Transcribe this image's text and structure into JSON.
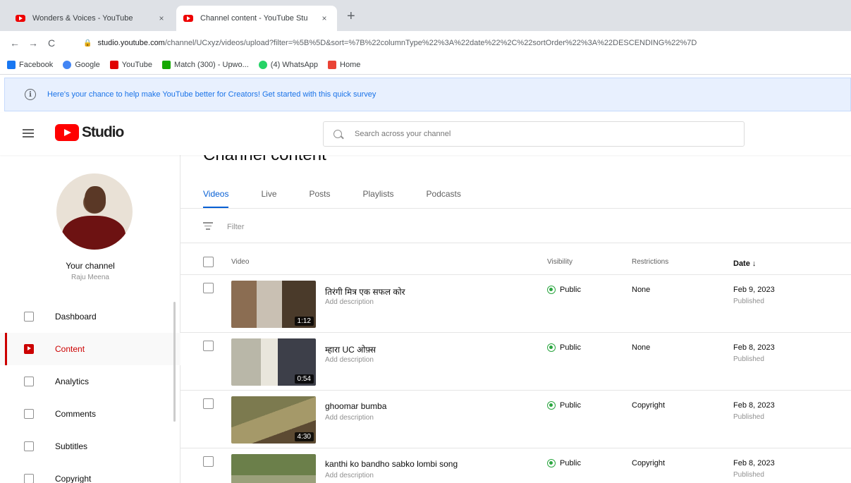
{
  "browser": {
    "tabs": [
      {
        "title": "Wonders & Voices - YouTube",
        "close": "×"
      },
      {
        "title": "Channel content - YouTube Stu",
        "close": "×"
      }
    ],
    "new_tab": "+",
    "nav": {
      "back": "←",
      "forward": "→",
      "reload": "C"
    },
    "url_host": "studio.youtube.com",
    "url_path": "/channel/UCxyz/videos/upload?filter=%5B%5D&sort=%7B%22columnType%22%3A%22date%22%2C%22sortOrder%22%3A%22DESCENDING%22%7D",
    "lock": "🔒",
    "bookmarks": [
      {
        "label": "Facebook",
        "color": "#1877f2"
      },
      {
        "label": "Google",
        "color": "#4285f4"
      },
      {
        "label": "YouTube",
        "color": "#e00000"
      },
      {
        "label": "Match (300) - Upwo...",
        "color": "#14a800"
      },
      {
        "label": "(4) WhatsApp",
        "color": "#25d366"
      },
      {
        "label": "Home",
        "color": "#ea4335"
      }
    ]
  },
  "survey": {
    "icon": "i",
    "text": "Here's your chance to help make YouTube better for Creators! Get started with this quick survey"
  },
  "studio": {
    "logo_text": "Studio",
    "search_placeholder": "Search across your channel"
  },
  "sidebar": {
    "channel_title": "Your channel",
    "channel_name": "Raju Meena",
    "items": [
      {
        "label": "Dashboard",
        "active": false
      },
      {
        "label": "Content",
        "active": true
      },
      {
        "label": "Analytics",
        "active": false
      },
      {
        "label": "Comments",
        "active": false
      },
      {
        "label": "Subtitles",
        "active": false
      },
      {
        "label": "Copyright",
        "active": false
      }
    ]
  },
  "main": {
    "title": "Channel content",
    "tabs": [
      "Videos",
      "Live",
      "Posts",
      "Playlists",
      "Podcasts"
    ],
    "filter": "Filter",
    "headers": {
      "video": "Video",
      "visibility": "Visibility",
      "restrictions": "Restrictions",
      "date": "Date ↓"
    },
    "rows": [
      {
        "title": "तिरंगी मित्र एक सफल कोर",
        "desc": "Add description",
        "duration": "1:12",
        "visibility": "Public",
        "restrictions": "None",
        "date": "Feb 9, 2023",
        "status": "Published",
        "colors": [
          "#8b6d52",
          "#c9c0b3",
          "#4a3a2a"
        ]
      },
      {
        "title": "म्हारा UC ओफ़्स",
        "desc": "Add description",
        "duration": "0:54",
        "visibility": "Public",
        "restrictions": "None",
        "date": "Feb 8, 2023",
        "status": "Published",
        "colors": [
          "#b9b7a8",
          "#e9e6dc",
          "#3d3f49"
        ]
      },
      {
        "title": "ghoomar bumba",
        "desc": "Add description",
        "duration": "4:30",
        "visibility": "Public",
        "restrictions": "Copyright",
        "date": "Feb 8, 2023",
        "status": "Published",
        "colors": [
          "#7c7a4f",
          "#a59969",
          "#5c4a32"
        ]
      },
      {
        "title": "kanthi ko bandho sabko lombi song",
        "desc": "Add description",
        "duration": "",
        "visibility": "Public",
        "restrictions": "Copyright",
        "date": "Feb 8, 2023",
        "status": "Published",
        "colors": [
          "#6b7f4a",
          "#9aa07a",
          "#465234"
        ]
      }
    ]
  }
}
